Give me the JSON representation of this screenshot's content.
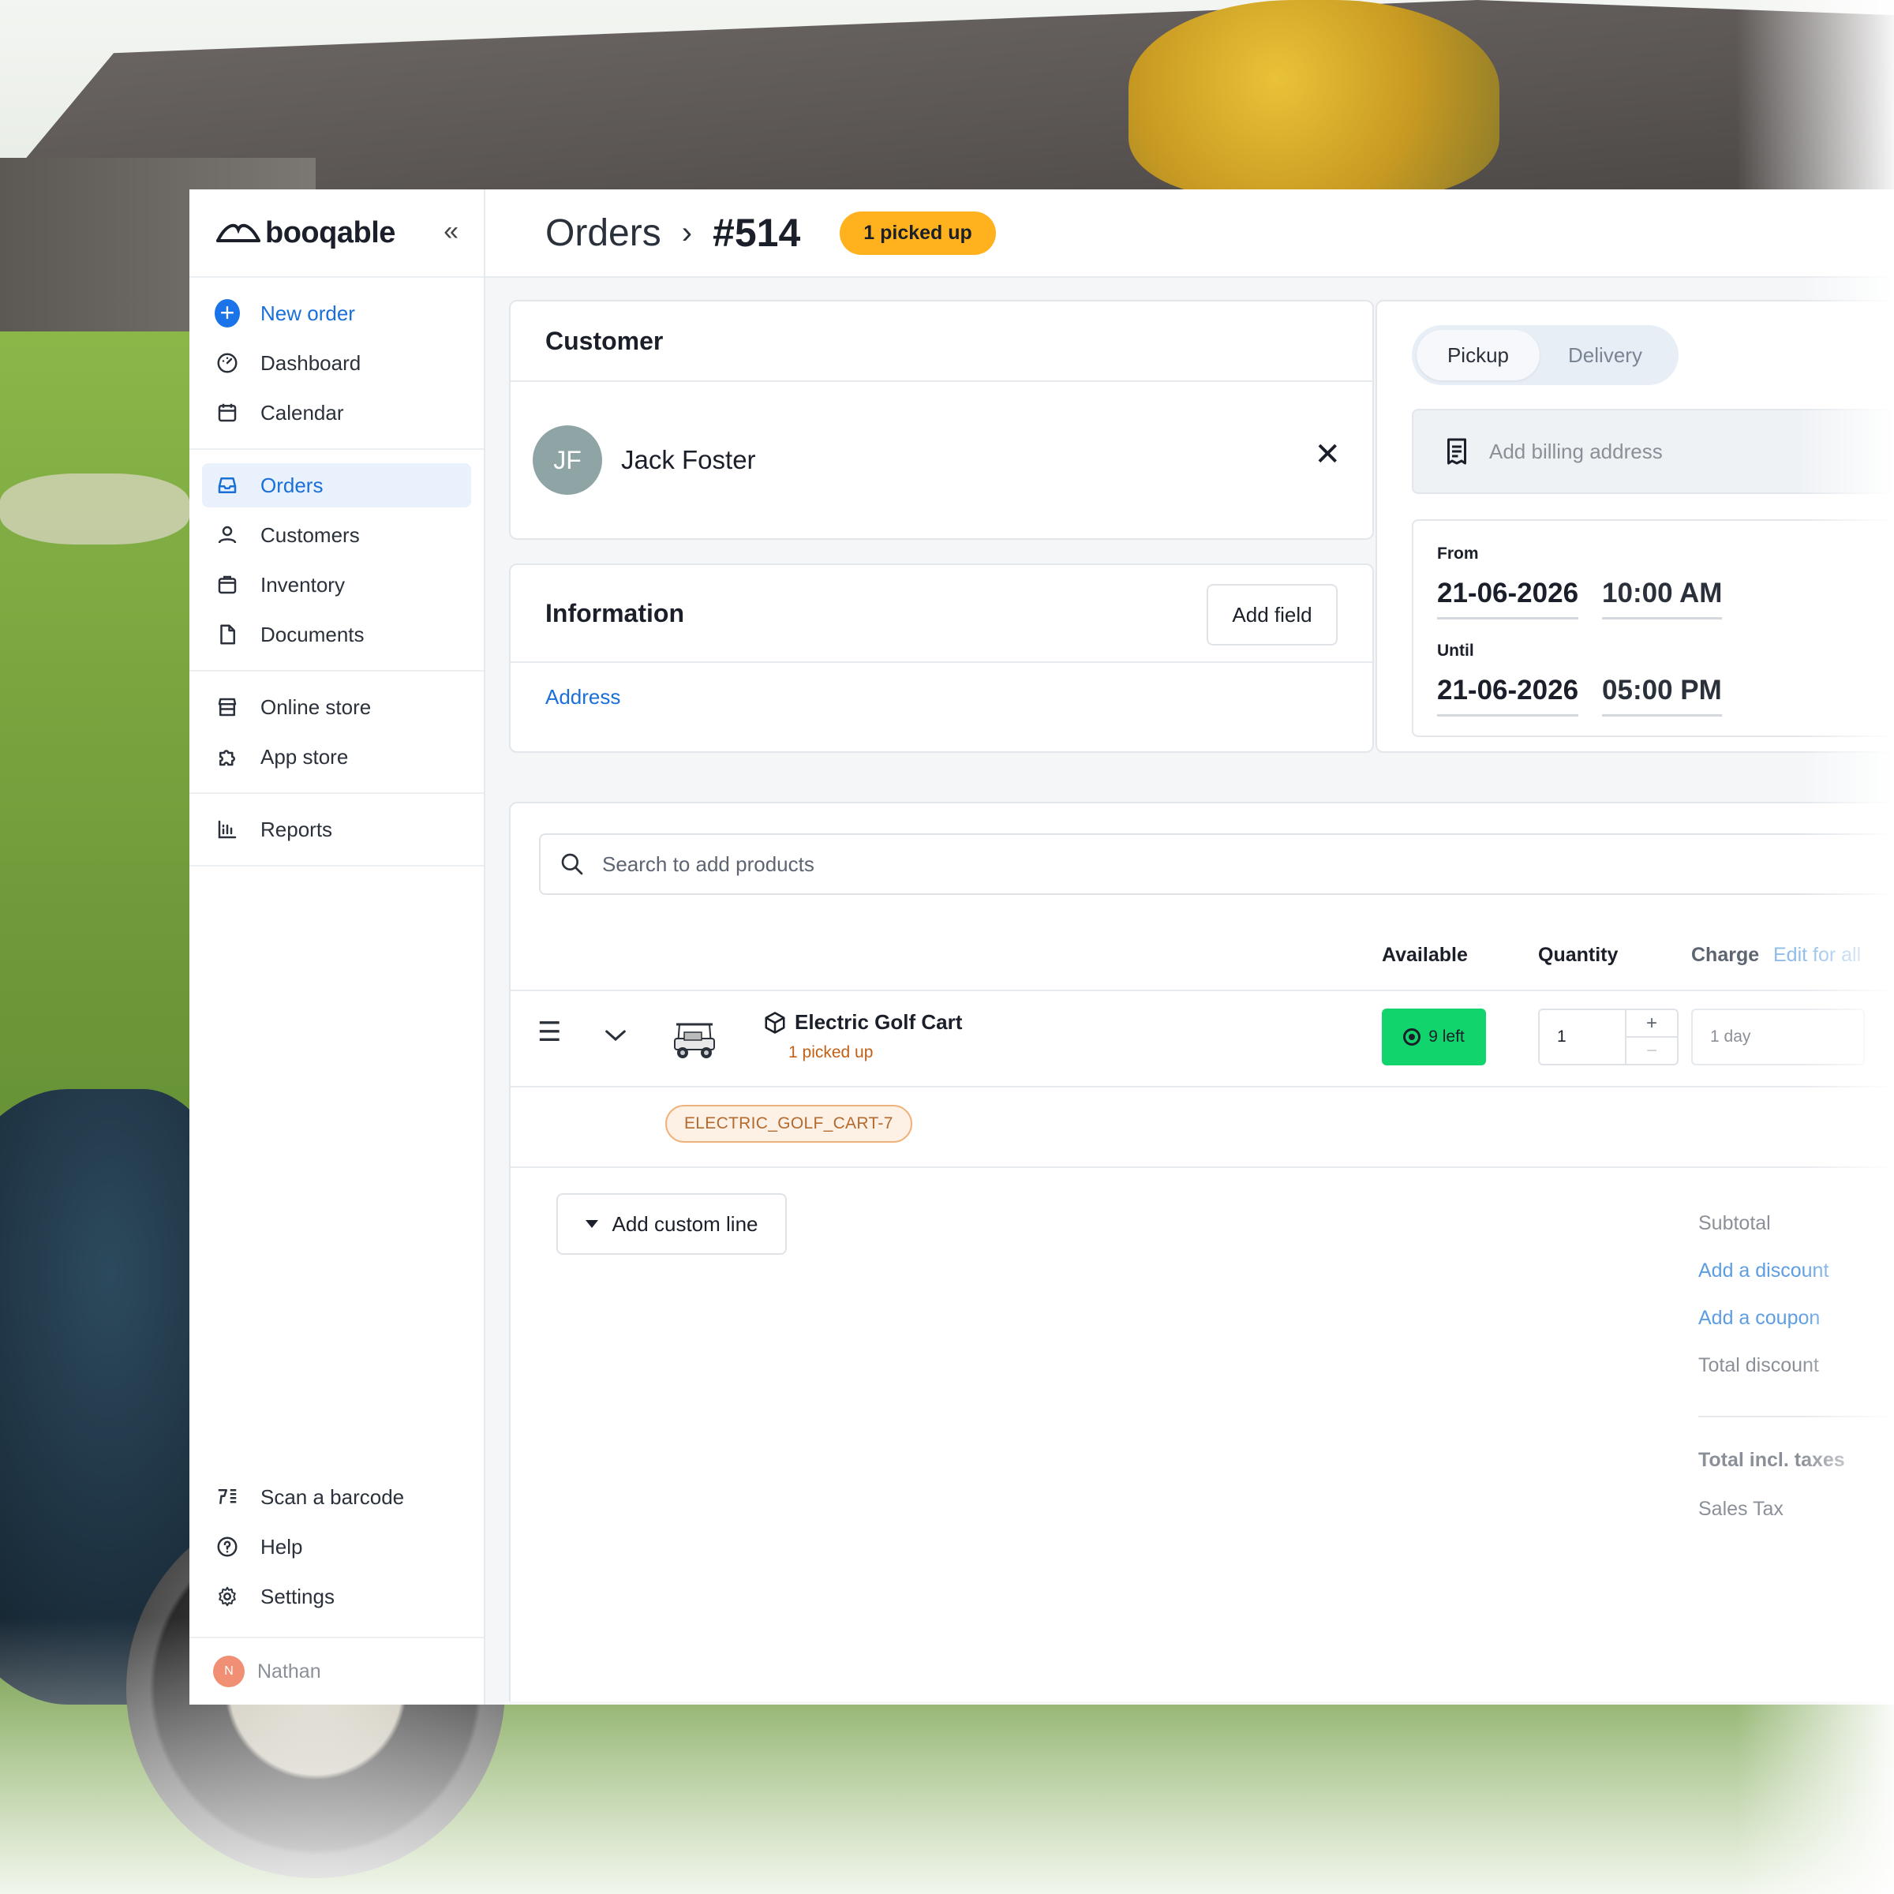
{
  "brand": {
    "name": "booqable"
  },
  "sidebar": {
    "new_order": "New order",
    "items": [
      {
        "label": "Dashboard"
      },
      {
        "label": "Calendar"
      },
      {
        "label": "Orders"
      },
      {
        "label": "Customers"
      },
      {
        "label": "Inventory"
      },
      {
        "label": "Documents"
      },
      {
        "label": "Online store"
      },
      {
        "label": "App store"
      },
      {
        "label": "Reports"
      }
    ],
    "tools": [
      {
        "label": "Scan a barcode"
      },
      {
        "label": "Help"
      },
      {
        "label": "Settings"
      }
    ],
    "user": {
      "initial": "N",
      "name": "Nathan"
    }
  },
  "header": {
    "breadcrumb": "Orders",
    "separator": "›",
    "order_number": "#514",
    "status": "1 picked up"
  },
  "customer": {
    "title": "Customer",
    "initials": "JF",
    "name": "Jack Foster"
  },
  "information": {
    "title": "Information",
    "add_field_label": "Add field",
    "address_link": "Address"
  },
  "fulfillment": {
    "tabs": [
      "Pickup",
      "Delivery"
    ],
    "selected": "Pickup",
    "billing_placeholder": "Add billing address",
    "from_label": "From",
    "from_date": "21-06-2026",
    "from_time": "10:00 AM",
    "until_label": "Until",
    "until_date": "21-06-2026",
    "until_time": "05:00 PM"
  },
  "products": {
    "search_placeholder": "Search to add products",
    "columns": {
      "available": "Available",
      "quantity": "Quantity",
      "charge": "Charge",
      "edit_all": "Edit for all"
    },
    "lines": [
      {
        "name": "Electric Golf Cart",
        "status": "1 picked up",
        "available": "9 left",
        "quantity": "1",
        "charge": "1 day",
        "sku": "ELECTRIC_GOLF_CART-7"
      }
    ],
    "add_custom_line": "Add custom line"
  },
  "totals": {
    "subtotal": "Subtotal",
    "add_discount": "Add a discount",
    "add_coupon": "Add a coupon",
    "total_discount": "Total discount",
    "total_incl_taxes": "Total incl. taxes",
    "sales_tax": "Sales Tax"
  },
  "colors": {
    "accent": "#1a73e8",
    "status_pill": "#ffb21e",
    "available_badge": "#12d46c",
    "sku_border": "#f0b27d"
  }
}
